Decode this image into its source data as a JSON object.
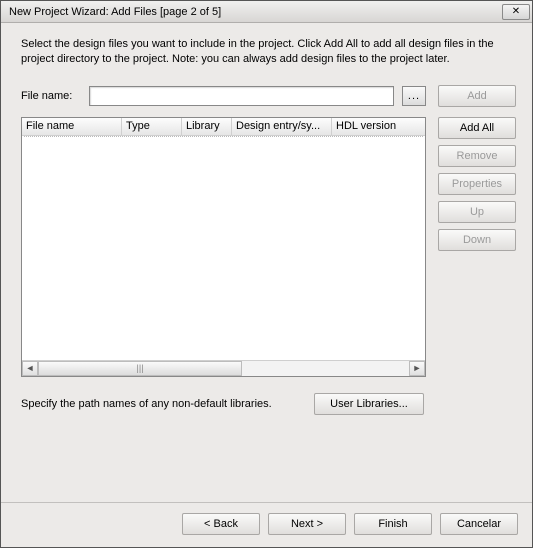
{
  "window": {
    "title": "New Project Wizard: Add Files [page 2 of 5]"
  },
  "instructions": "Select the design files you want to include in the project. Click Add All to add all design files in the project directory to the project. Note: you can always add design files to the project later.",
  "file_name": {
    "label": "File name:",
    "value": "",
    "browse_label": "..."
  },
  "table": {
    "columns": [
      "File name",
      "Type",
      "Library",
      "Design entry/sy...",
      "HDL version"
    ],
    "rows": []
  },
  "side_buttons": {
    "add": "Add",
    "add_all": "Add All",
    "remove": "Remove",
    "properties": "Properties",
    "up": "Up",
    "down": "Down"
  },
  "libraries": {
    "text": "Specify the path names of any non-default libraries.",
    "button": "User Libraries..."
  },
  "footer": {
    "back": "< Back",
    "next": "Next >",
    "finish": "Finish",
    "cancel": "Cancelar"
  }
}
